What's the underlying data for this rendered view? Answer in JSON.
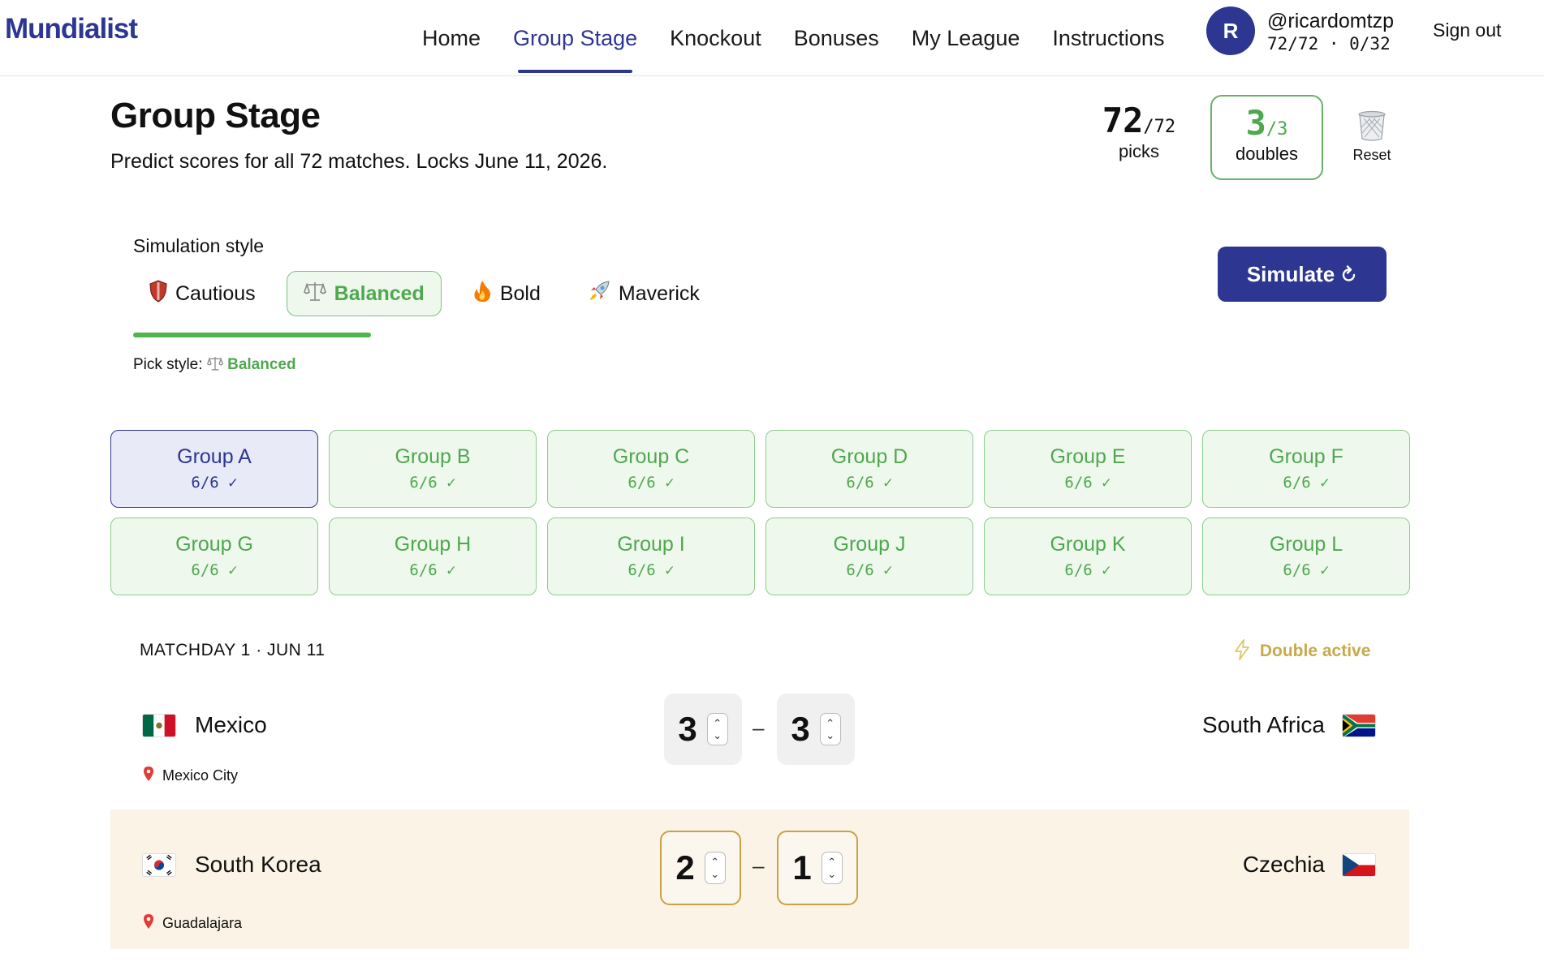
{
  "header": {
    "logo": "Mundialist",
    "nav": [
      "Home",
      "Group Stage",
      "Knockout",
      "Bonuses",
      "My League",
      "Instructions"
    ],
    "active_nav": "Group Stage",
    "user": {
      "initial": "R",
      "handle": "@ricardomtzp",
      "stats": "72/72 · 0/32"
    },
    "sign_out": "Sign out"
  },
  "page": {
    "title": "Group Stage",
    "subtitle": "Predict scores for all 72 matches. Locks June 11, 2026.",
    "picks": {
      "value": "72",
      "total": "/72",
      "label": "picks"
    },
    "doubles": {
      "value": "3",
      "total": "/3",
      "label": "doubles"
    },
    "reset_label": "Reset"
  },
  "simulation": {
    "title": "Simulation style",
    "styles": [
      {
        "icon": "shield-icon",
        "label": "Cautious"
      },
      {
        "icon": "scales-icon",
        "label": "Balanced"
      },
      {
        "icon": "fire-icon",
        "label": "Bold"
      },
      {
        "icon": "rocket-icon",
        "label": "Maverick"
      }
    ],
    "active_style": "Balanced",
    "pick_style_label": "Pick style:",
    "pick_style_value": "Balanced",
    "simulate_label": "Simulate"
  },
  "groups": [
    {
      "name": "Group A",
      "progress": "6/6 ✓"
    },
    {
      "name": "Group B",
      "progress": "6/6 ✓"
    },
    {
      "name": "Group C",
      "progress": "6/6 ✓"
    },
    {
      "name": "Group D",
      "progress": "6/6 ✓"
    },
    {
      "name": "Group E",
      "progress": "6/6 ✓"
    },
    {
      "name": "Group F",
      "progress": "6/6 ✓"
    },
    {
      "name": "Group G",
      "progress": "6/6 ✓"
    },
    {
      "name": "Group H",
      "progress": "6/6 ✓"
    },
    {
      "name": "Group I",
      "progress": "6/6 ✓"
    },
    {
      "name": "Group J",
      "progress": "6/6 ✓"
    },
    {
      "name": "Group K",
      "progress": "6/6 ✓"
    },
    {
      "name": "Group L",
      "progress": "6/6 ✓"
    }
  ],
  "active_group": "Group A",
  "matchday": {
    "label": "MATCHDAY 1 · JUN 11",
    "double_label": "Double active",
    "matches": [
      {
        "home": "Mexico",
        "away": "South Africa",
        "home_score": "3",
        "away_score": "3",
        "venue": "Mexico City",
        "doubled": false
      },
      {
        "home": "South Korea",
        "away": "Czechia",
        "home_score": "2",
        "away_score": "1",
        "venue": "Guadalajara",
        "doubled": true
      }
    ]
  },
  "colors": {
    "brand": "#2d3691",
    "success": "#4fa84f",
    "gold": "#c8a24a",
    "double_bg": "#fbf3e6"
  }
}
